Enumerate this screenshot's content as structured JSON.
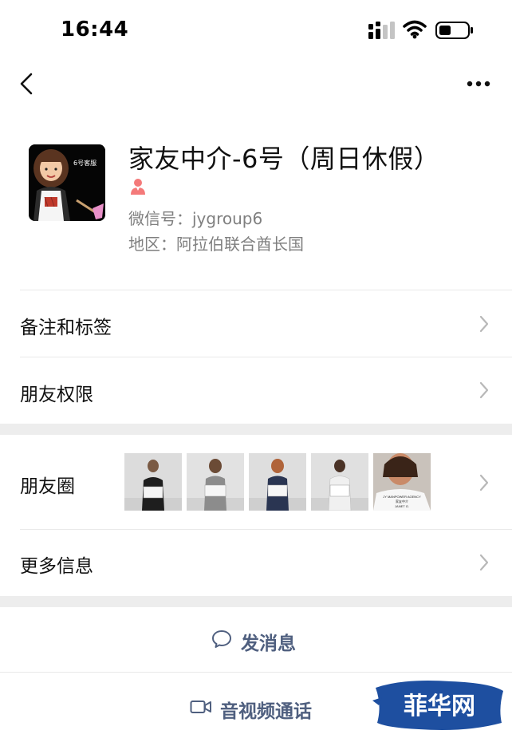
{
  "status_bar": {
    "time": "16:44"
  },
  "nav": {
    "back_icon": "chevron-left-icon",
    "more_icon": "ellipsis-icon"
  },
  "profile": {
    "name": "家友中介-6号（周日休假）",
    "avatar_tag": "6号客服",
    "wechat_id": "微信号：jygroup6",
    "region": "地区：阿拉伯联合酋长国",
    "gender_icon": "female-icon",
    "gender_color": "#f47a7a"
  },
  "rows": {
    "notes_tags": "备注和标签",
    "permissions": "朋友权限",
    "moments": "朋友圈",
    "more_info": "更多信息"
  },
  "moments_thumbs": [
    {
      "kind": "photo",
      "icon": "photo-thumbnail"
    },
    {
      "kind": "photo",
      "icon": "photo-thumbnail"
    },
    {
      "kind": "photo",
      "icon": "photo-thumbnail"
    },
    {
      "kind": "photo",
      "icon": "photo-thumbnail"
    },
    {
      "kind": "photo",
      "icon": "photo-thumbnail",
      "caption_lines": [
        "JY MANPOWER AGENCY",
        "家友中介",
        "JANET G."
      ]
    }
  ],
  "actions": {
    "send_message": "发消息",
    "video_call": "音视频通话"
  },
  "watermark": {
    "text": "菲华网",
    "color": "#1e4fa0"
  },
  "colors": {
    "link_text": "#4f5f7f",
    "separator": "#ededed",
    "secondary_text": "#7f7f7f"
  }
}
